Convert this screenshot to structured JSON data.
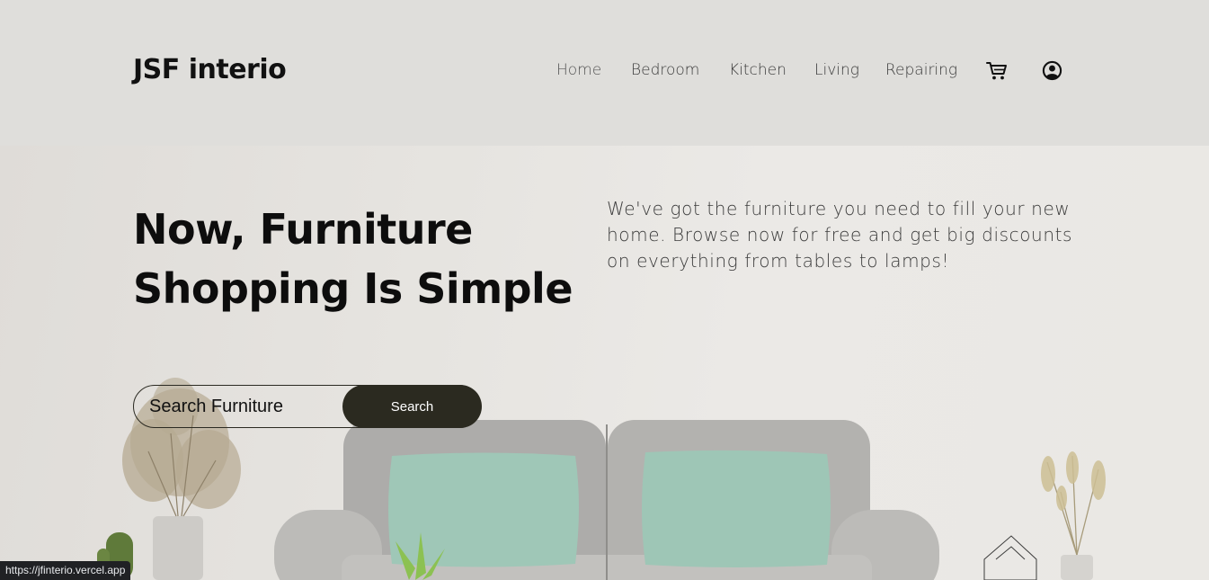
{
  "brand": {
    "name": "JSF interio"
  },
  "nav": {
    "items": [
      {
        "label": "Home"
      },
      {
        "label": "Bedroom"
      },
      {
        "label": "Kitchen"
      },
      {
        "label": "Living"
      },
      {
        "label": "Repairing"
      }
    ],
    "cart_icon": "cart-icon",
    "user_icon": "user-circle-icon"
  },
  "hero": {
    "headline_line1": "Now, Furniture",
    "headline_line2": "Shopping Is Simple",
    "description": "We've got the furniture you need to fill your new home. Browse now for free and get big discounts on everything from tables to lamps!"
  },
  "search": {
    "placeholder": "Search Furniture",
    "button_label": "Search"
  },
  "status_bar": {
    "url": "https://jfinterio.vercel.app"
  },
  "colors": {
    "header_bg": "#dfdedb",
    "hero_bg": "#e8e6e2",
    "button_bg": "#2b2a20",
    "pillow": "#9fc7b7",
    "sofa": "#b5b4b1"
  }
}
